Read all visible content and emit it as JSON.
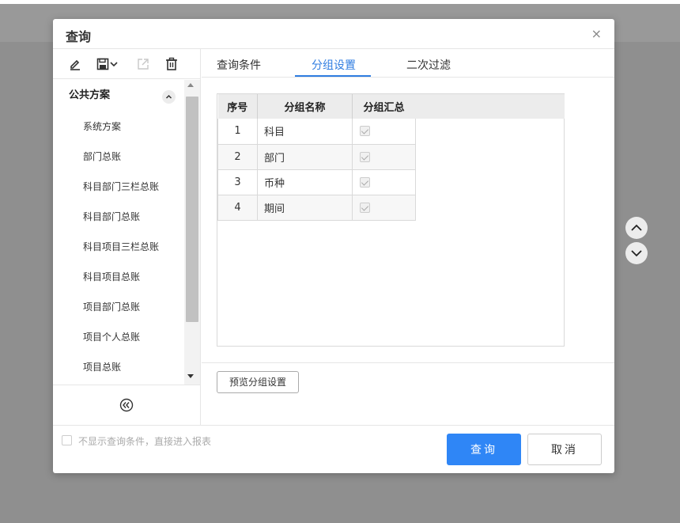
{
  "dialog": {
    "title": "查询",
    "close_glyph": "×"
  },
  "toolbar": {
    "icons": [
      "edit-icon",
      "save-icon",
      "dropdown-chevron-icon",
      "export-icon",
      "delete-icon"
    ]
  },
  "schemes": {
    "group_label": "公共方案",
    "items": [
      "系统方案",
      "部门总账",
      "科目部门三栏总账",
      "科目部门总账",
      "科目项目三栏总账",
      "科目项目总账",
      "项目部门总账",
      "项目个人总账",
      "项目总账"
    ]
  },
  "tabs": [
    "查询条件",
    "分组设置",
    "二次过滤"
  ],
  "active_tab": "分组设置",
  "grid": {
    "headers": [
      "序号",
      "分组名称",
      "分组汇总"
    ],
    "rows": [
      {
        "no": "1",
        "name": "科目",
        "summary": true
      },
      {
        "no": "2",
        "name": "部门",
        "summary": true
      },
      {
        "no": "3",
        "name": "币种",
        "summary": true
      },
      {
        "no": "4",
        "name": "期间",
        "summary": true
      }
    ]
  },
  "preview_button": "预览分组设置",
  "footer": {
    "skip_label": "不显示查询条件，直接进入报表",
    "skip_checked": false,
    "query_button": "查询",
    "cancel_button": "取消"
  },
  "colors": {
    "accent": "#2f86f6",
    "tab_active": "#2f7de1",
    "overlay": "#8f8f8f"
  }
}
